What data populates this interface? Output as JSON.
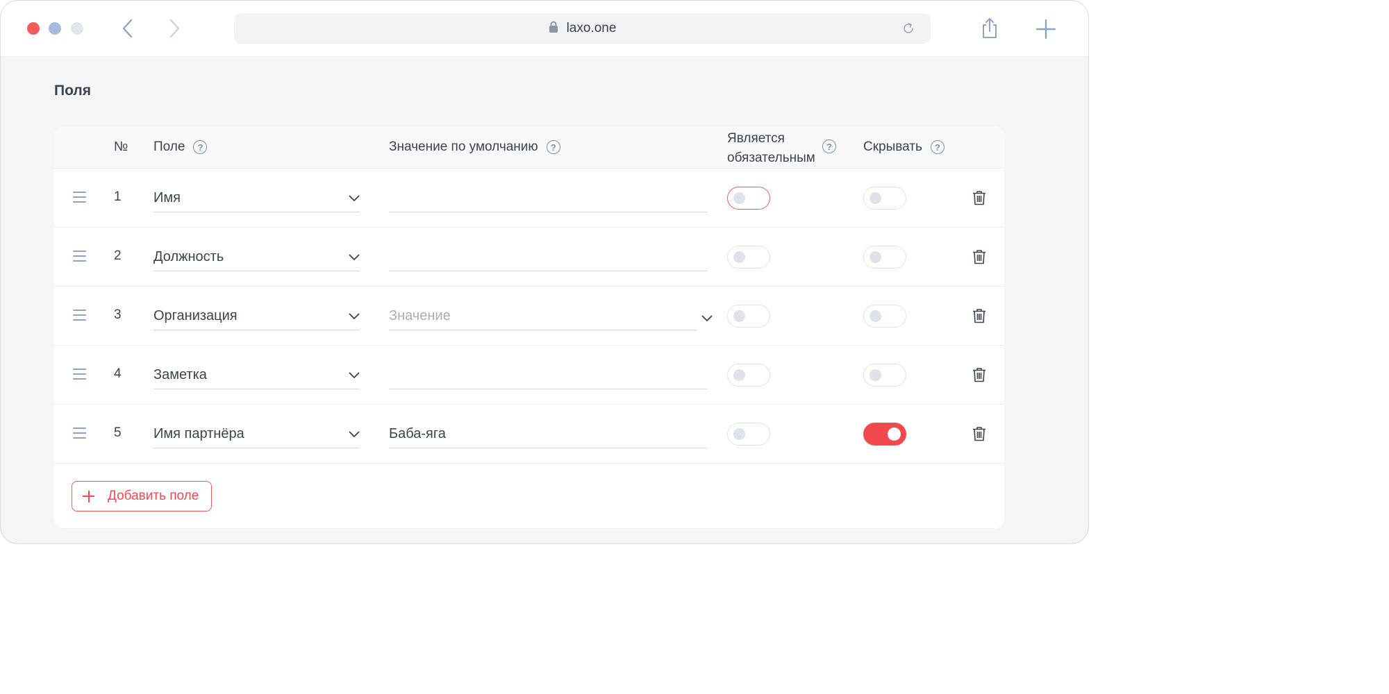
{
  "browser": {
    "url": "laxo.one",
    "icons": [
      "back-icon",
      "forward-icon",
      "lock-icon",
      "reload-icon",
      "share-icon",
      "new-tab-icon"
    ]
  },
  "page": {
    "title": "Поля"
  },
  "table": {
    "headers": {
      "num": "№",
      "field": "Поле",
      "default": "Значение по умолчанию",
      "required_line1": "Является",
      "required_line2": "обязательным",
      "hide": "Скрывать"
    },
    "rows": [
      {
        "num": "1",
        "field": "Имя",
        "default_value": "",
        "required": false,
        "hidden": false
      },
      {
        "num": "2",
        "field": "Должность",
        "default_value": "",
        "required": false,
        "hidden": false
      },
      {
        "num": "3",
        "field": "Организация",
        "default_placeholder": "Значение",
        "required": false,
        "hidden": false
      },
      {
        "num": "4",
        "field": "Заметка",
        "default_value": "",
        "required": false,
        "hidden": false
      },
      {
        "num": "5",
        "field": "Имя партнёра",
        "default_value": "Баба-яга",
        "required": false,
        "hidden": true
      }
    ]
  },
  "actions": {
    "add_field": "Добавить поле"
  },
  "colors": {
    "accent": "#f2494e",
    "link_icon": "#8ea2c4",
    "background": "#f4f5f7"
  }
}
